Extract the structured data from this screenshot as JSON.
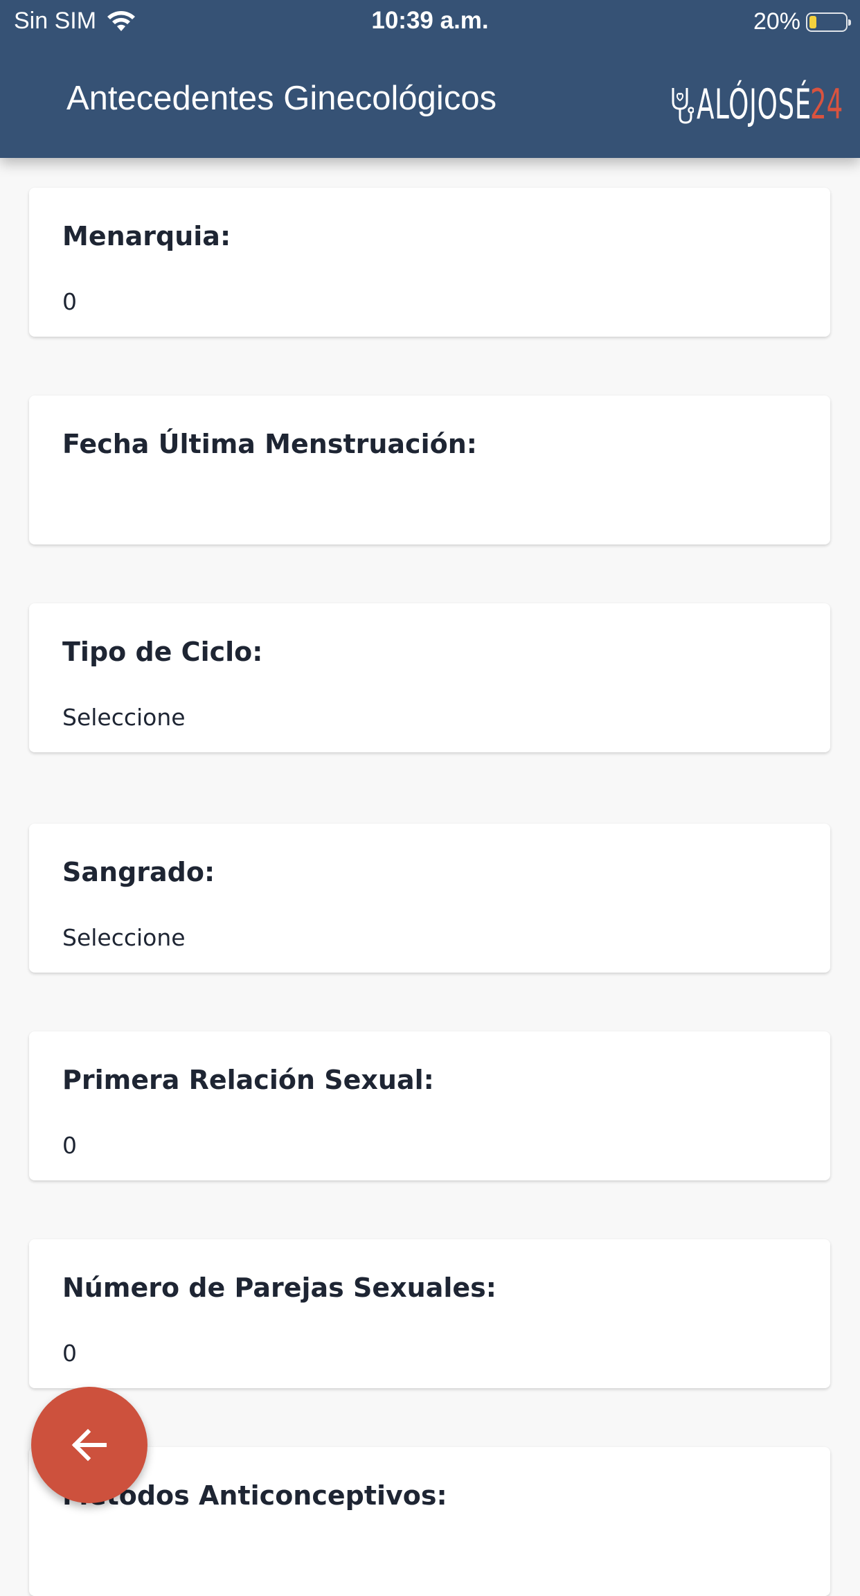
{
  "status_bar": {
    "carrier": "Sin SIM",
    "time": "10:39 a.m.",
    "battery_percent": "20%",
    "battery_level": 0.2
  },
  "header": {
    "title": "Antecedentes Ginecológicos",
    "logo_text": "ALÓJOSÉ",
    "logo_number": "24"
  },
  "fields": [
    {
      "label": "Menarquia:",
      "value": "0"
    },
    {
      "label": "Fecha Última Menstruación:",
      "value": ""
    },
    {
      "label": "Tipo de Ciclo:",
      "value": "Seleccione"
    },
    {
      "label": "Sangrado:",
      "value": "Seleccione"
    },
    {
      "label": "Primera Relación Sexual:",
      "value": "0"
    },
    {
      "label": "Número de Parejas Sexuales:",
      "value": "0"
    },
    {
      "label": "Métodos Anticonceptivos:",
      "value": ""
    }
  ],
  "fab": {
    "icon": "arrow-left-icon"
  },
  "colors": {
    "header_bg": "#365275",
    "accent": "#cd513d",
    "battery": "#f4d13d"
  }
}
